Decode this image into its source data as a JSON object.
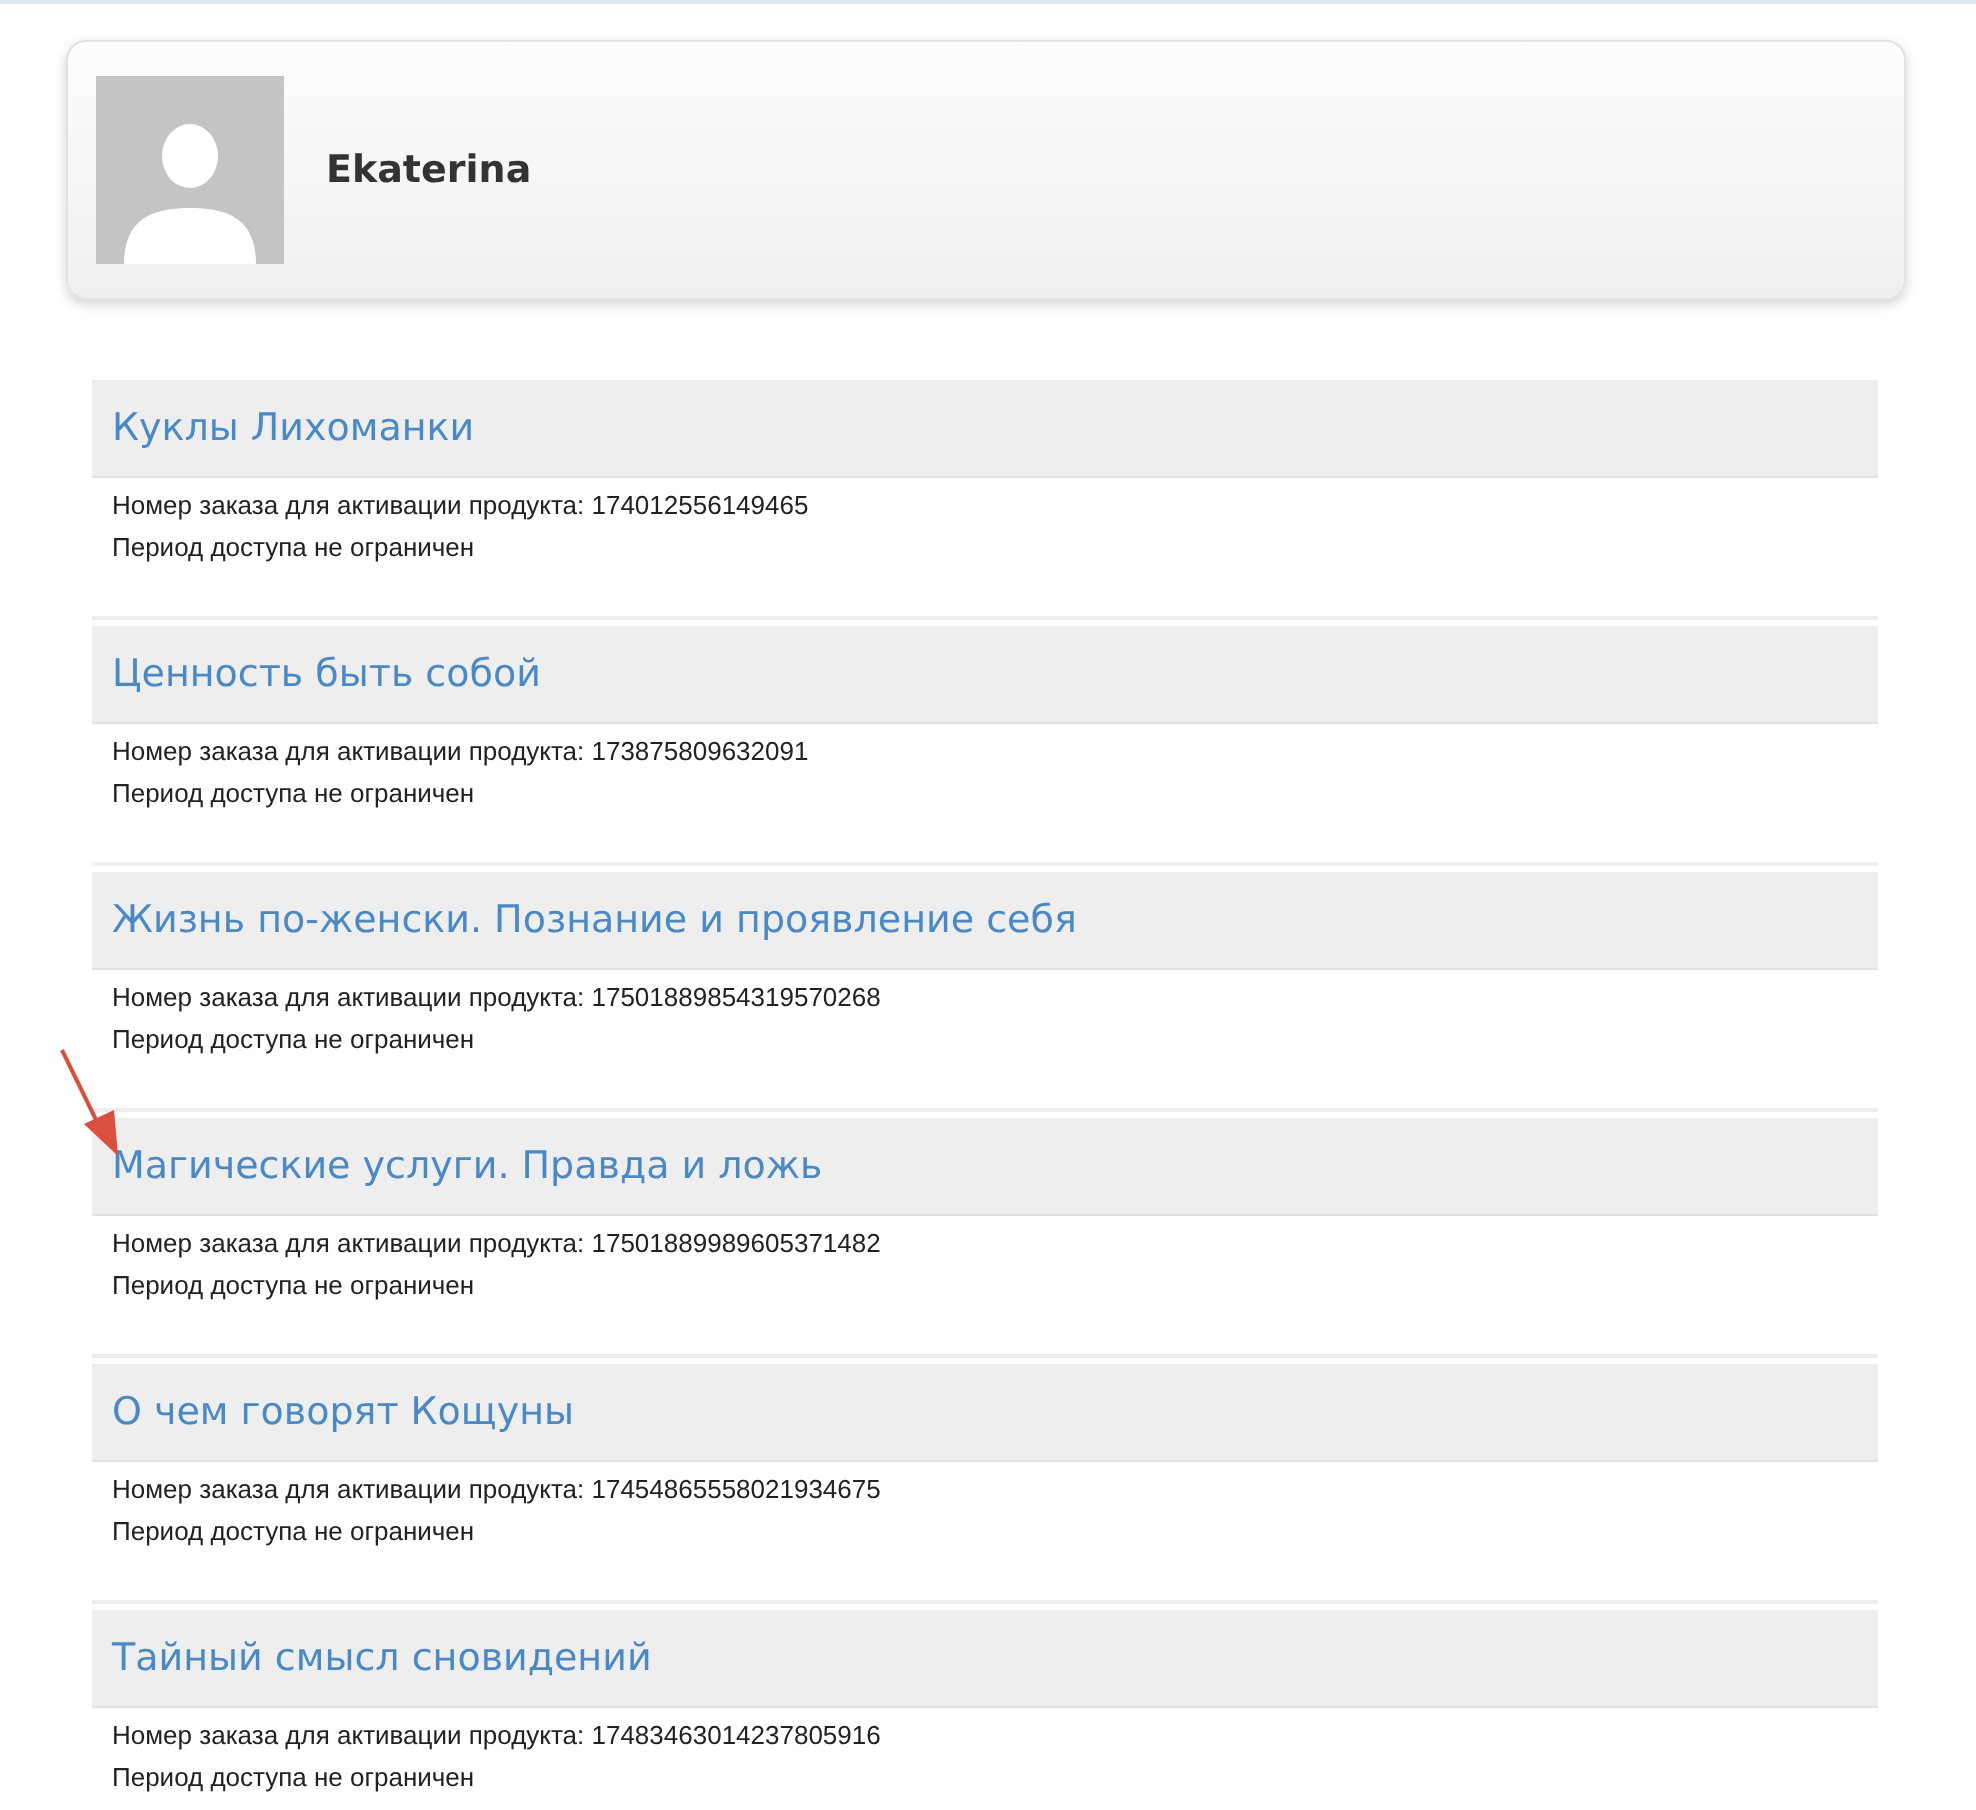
{
  "profile": {
    "name": "Ekaterina"
  },
  "products": [
    {
      "title": "Куклы Лихоманки",
      "order": "Номер заказа для активации продукта: 174012556149465",
      "access": "Период доступа не ограничен"
    },
    {
      "title": "Ценность быть собой",
      "order": "Номер заказа для активации продукта: 173875809632091",
      "access": "Период доступа не ограничен"
    },
    {
      "title": "Жизнь по-женски. Познание и проявление себя",
      "order": "Номер заказа для активации продукта: 17501889854319570268",
      "access": "Период доступа не ограничен"
    },
    {
      "title": "Магические услуги. Правда и ложь",
      "order": "Номер заказа для активации продукта: 17501889989605371482",
      "access": "Период доступа не ограничен"
    },
    {
      "title": "О чем говорят Кощуны",
      "order": "Номер заказа для активации продукта: 17454865558021934675",
      "access": "Период доступа не ограничен"
    },
    {
      "title": "Тайный смысл сновидений",
      "order": "Номер заказа для активации продукта: 17483463014237805916",
      "access": "Период доступа не ограничен"
    }
  ]
}
